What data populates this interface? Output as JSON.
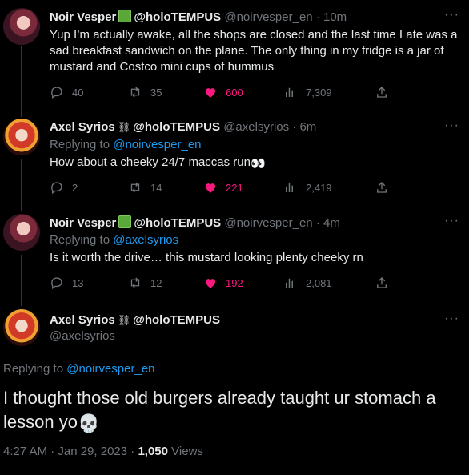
{
  "tweets": [
    {
      "name": "Noir Vesper",
      "org": "@holoTEMPUS",
      "handle": "@noirvesper_en",
      "time": "· 10m",
      "text": "Yup I’m actually awake, all the shops are closed and the last time I ate was a sad breakfast sandwich on the plane. The only thing in my fridge is a jar of mustard and Costco mini cups of hummus",
      "replies": "40",
      "retweets": "35",
      "likes": "600",
      "views": "7,309"
    },
    {
      "name": "Axel Syrios",
      "org": "@holoTEMPUS",
      "handle": "@axelsyrios",
      "time": "· 6m",
      "reply_prefix": "Replying to",
      "reply_to": "@noirvesper_en",
      "text": "How about a cheeky 24/7 maccas run",
      "emoji": "👀",
      "replies": "2",
      "retweets": "14",
      "likes": "221",
      "views": "2,419"
    },
    {
      "name": "Noir Vesper",
      "org": "@holoTEMPUS",
      "handle": "@noirvesper_en",
      "time": "· 4m",
      "reply_prefix": "Replying to",
      "reply_to": "@axelsyrios",
      "text": "Is it worth the drive… this mustard looking plenty cheeky rn",
      "replies": "13",
      "retweets": "12",
      "likes": "192",
      "views": "2,081"
    }
  ],
  "main": {
    "name": "Axel Syrios",
    "org": "@holoTEMPUS",
    "handle": "@axelsyrios",
    "reply_prefix": "Replying to",
    "reply_to": "@noirvesper_en",
    "text": "I thought those old burgers already taught ur stomach a lesson yo",
    "emoji": "💀",
    "timestamp": "4:27 AM · Jan 29, 2023 ·",
    "views_count": "1,050",
    "views_label": "Views"
  },
  "more_label": "···",
  "colors": {
    "like": "#f91880",
    "link": "#1d9bf0",
    "muted": "#71767b"
  }
}
